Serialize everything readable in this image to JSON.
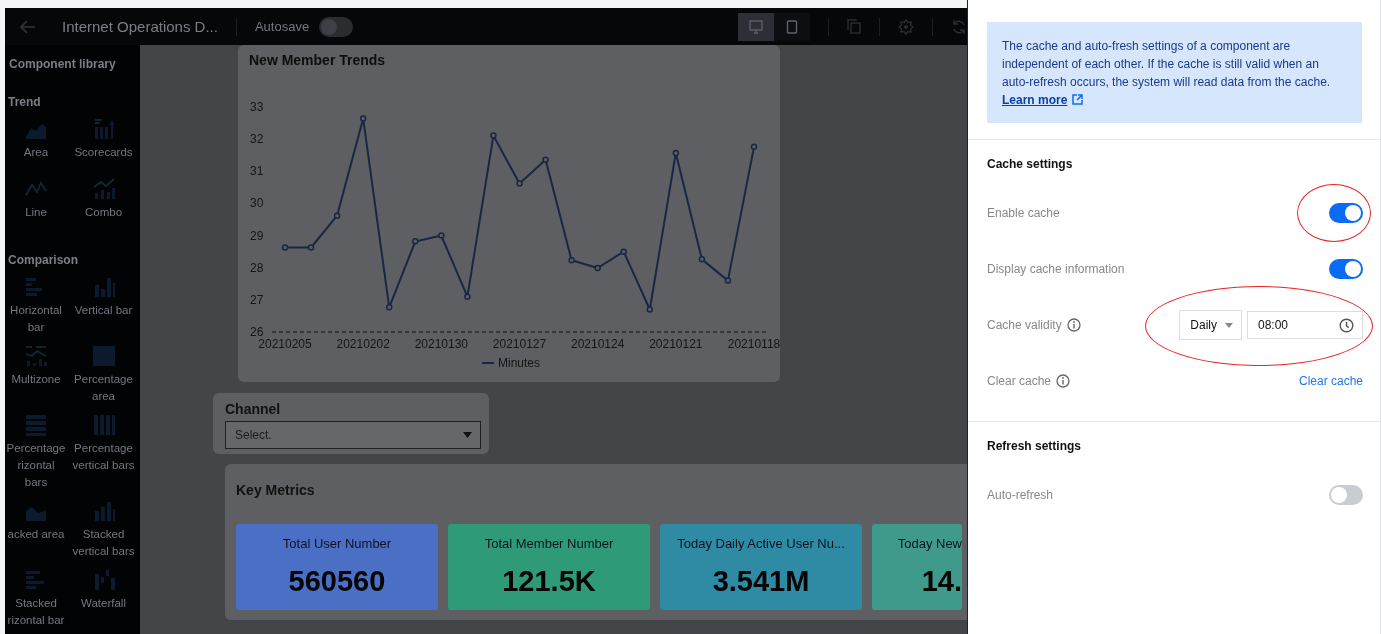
{
  "topbar": {
    "title": "Internet Operations D...",
    "autosave": {
      "label": "Autosave",
      "on": false
    },
    "view_modes": [
      {
        "kind": "desktop",
        "selected": true
      },
      {
        "kind": "tablet",
        "selected": false
      }
    ],
    "tools": [
      {
        "kind": "copy"
      },
      {
        "kind": "settings"
      },
      {
        "kind": "refresh"
      }
    ]
  },
  "sidebar": {
    "title": "Component library",
    "sections": [
      {
        "title": "Trend",
        "items": [
          {
            "label": "Area",
            "kind": "area"
          },
          {
            "label": "Scorecards",
            "kind": "scorecard"
          },
          {
            "label": "Line",
            "kind": "line"
          },
          {
            "label": "Combo",
            "kind": "combo"
          }
        ]
      },
      {
        "title": "Comparison",
        "items": [
          {
            "label": "Horizontal bar",
            "kind": "hbar"
          },
          {
            "label": "Vertical bar",
            "kind": "vbar"
          },
          {
            "label": "Multizone",
            "kind": "multizone"
          },
          {
            "label": "Percentage area",
            "kind": "pctarea"
          },
          {
            "label": "Percentage rizontal bars",
            "kind": "pcthbar"
          },
          {
            "label": "Percentage vertical bars",
            "kind": "pctvbar"
          },
          {
            "label": "acked area",
            "kind": "stackarea"
          },
          {
            "label": "Stacked vertical bars",
            "kind": "stackvbar"
          },
          {
            "label": "Stacked rizontal bar",
            "kind": "stackhbar"
          },
          {
            "label": "Waterfall",
            "kind": "waterfall"
          }
        ]
      }
    ]
  },
  "trend_card": {
    "title": "New Member Trends",
    "chart_data": {
      "type": "line",
      "categories": [
        "20210205",
        null,
        null,
        "20210202",
        null,
        null,
        "20210130",
        null,
        null,
        "20210127",
        null,
        null,
        "20210124",
        null,
        null,
        "20210121",
        null,
        null,
        "20210118"
      ],
      "series": [
        {
          "name": "Minutes",
          "color": "#1a2744",
          "marker": true,
          "values": [
            28.63,
            28.63,
            29.62,
            32.64,
            26.77,
            28.82,
            29.0,
            27.1,
            32.11,
            30.62,
            31.36,
            28.23,
            27.99,
            28.5,
            26.7,
            31.57,
            28.26,
            27.6,
            31.76
          ]
        }
      ],
      "ylim": [
        26,
        33
      ],
      "yticks": [
        26,
        27,
        28,
        29,
        30,
        31,
        32,
        33
      ]
    }
  },
  "channel_filter": {
    "label": "Channel",
    "placeholder": "Select."
  },
  "key_metrics": {
    "title": "Key Metrics",
    "cards": [
      {
        "label": "Total User Number",
        "value": "560560",
        "color": "#4a6fc4"
      },
      {
        "label": "Total Member Number",
        "value": "121.5K",
        "color": "#2f9a78"
      },
      {
        "label": "Today Daily Active User Nu...",
        "value": "3.541M",
        "color": "#2f8aa3"
      },
      {
        "label": "Today New",
        "value": "14.",
        "color": "#3f9a8c"
      }
    ]
  },
  "panel": {
    "notice": "The cache and auto-fresh settings of a component are independent of each other. If the cache is still valid when an auto-refresh occurs, the system will read data from the cache.",
    "notice_link": "Learn more",
    "sections": [
      {
        "title": "Cache settings",
        "rows": [
          {
            "kind": "toggle",
            "label": "Enable cache",
            "info": false,
            "on": true,
            "highlighted": true
          },
          {
            "kind": "toggle",
            "label": "Display cache information",
            "info": false,
            "on": true,
            "highlighted": false
          },
          {
            "kind": "schedule",
            "label": "Cache validity",
            "info": true,
            "select": "Daily",
            "time": "08:00",
            "highlighted": true
          },
          {
            "kind": "link",
            "label": "Clear cache",
            "info": true,
            "link": "Clear cache",
            "highlighted": false
          }
        ]
      },
      {
        "title": "Refresh settings",
        "rows": [
          {
            "kind": "toggle",
            "label": "Auto-refresh",
            "info": false,
            "on": false,
            "highlighted": false
          }
        ]
      }
    ]
  }
}
